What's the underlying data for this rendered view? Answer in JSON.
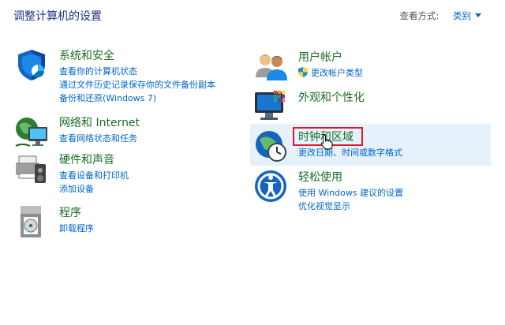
{
  "header": {
    "title": "调整计算机的设置",
    "view_by_label": "查看方式:",
    "view_by_value": "类别"
  },
  "left_categories": [
    {
      "title": "系统和安全",
      "icon": "system-security-icon",
      "links": [
        "查看你的计算机状态",
        "通过文件历史记录保存你的文件备份副本",
        "备份和还原(Windows 7)"
      ]
    },
    {
      "title": "网络和 Internet",
      "icon": "network-internet-icon",
      "links": [
        "查看网络状态和任务"
      ]
    },
    {
      "title": "硬件和声音",
      "icon": "hardware-sound-icon",
      "links": [
        "查看设备和打印机",
        "添加设备"
      ]
    },
    {
      "title": "程序",
      "icon": "programs-icon",
      "links": [
        "卸载程序"
      ]
    }
  ],
  "right_categories": [
    {
      "title": "用户帐户",
      "icon": "user-accounts-icon",
      "links": [
        "更改帐户类型"
      ],
      "link_icon": "uac-shield-icon"
    },
    {
      "title": "外观和个性化",
      "icon": "appearance-personalization-icon",
      "links": []
    },
    {
      "title": "时钟和区域",
      "icon": "clock-region-icon",
      "links": [
        "更改日期、时间或数字格式"
      ]
    },
    {
      "title": "轻松使用",
      "icon": "ease-of-access-icon",
      "links": [
        "使用 Windows 建议的设置",
        "优化视觉显示"
      ]
    }
  ],
  "colors": {
    "title_blue": "#1e3287",
    "category_green": "#1a6b24",
    "link_blue": "#0066cc",
    "hover_bg": "#e5f1fb",
    "highlight_red": "#e0182b"
  }
}
